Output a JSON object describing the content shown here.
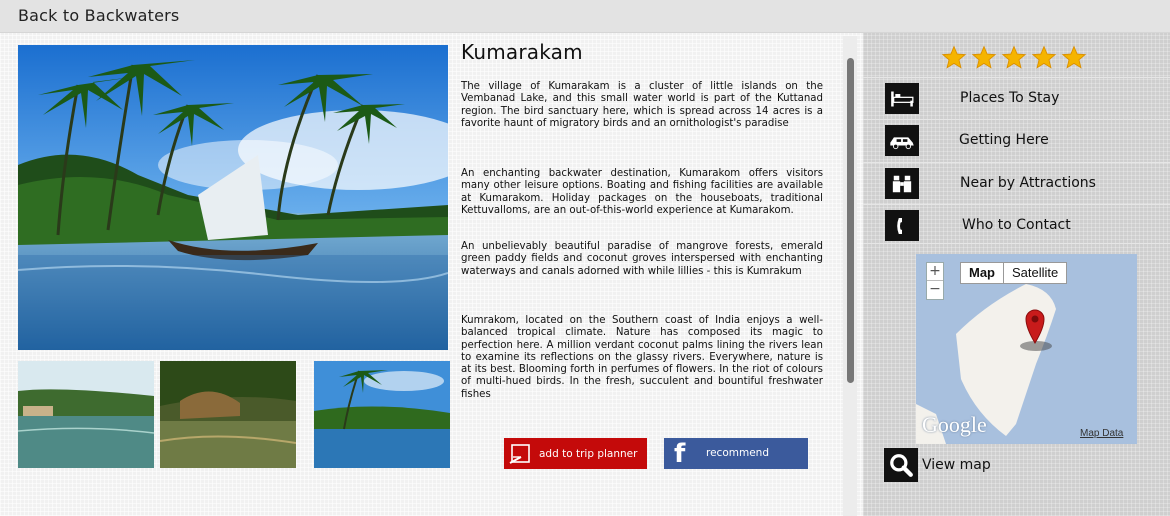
{
  "nav": {
    "back_label": "Back to Backwaters"
  },
  "article": {
    "title": "Kumarakam",
    "paragraphs": [
      "The village of Kumarakam is a cluster of little islands on the Vembanad Lake, and this small water world is part of the Kuttanad region. The bird sanctuary here, which is spread across 14 acres is a favorite haunt of migratory birds and an ornithologist's paradise",
      "An enchanting backwater destination, Kumarakom offers visitors many other leisure options. Boating and fishing facilities are available at Kumarakom. Holiday packages on the houseboats, traditional Kettuvalloms, are an out-of-this-world experience at Kumarakom.",
      "An unbelievably beautiful paradise of mangrove forests, emerald green paddy fields and coconut groves interspersed with enchanting waterways and canals adorned with while lillies - this is Kumrakum",
      "Kumrakom, located on the Southern coast of India enjoys a well-balanced tropical climate. Nature has composed its magic to perfection here. A million verdant coconut palms lining the rivers lean to examine its reflections on the glassy rivers. Everywhere, nature is at its best. Blooming forth in perfumes of flowers. In the riot of colours of multi-hued birds. In the fresh, succulent and bountiful freshwater fishes"
    ]
  },
  "actions": {
    "trip_label": "add to trip planner",
    "recommend_label": "recommend",
    "trip_color": "#c40a0a",
    "recommend_color": "#3b5a9c"
  },
  "sidebar": {
    "rating": 5,
    "star_color": "#f5b400",
    "menu": [
      {
        "label": "Places To Stay",
        "icon": "bed-icon"
      },
      {
        "label": "Getting Here",
        "icon": "car-icon"
      },
      {
        "label": "Near by Attractions",
        "icon": "binoculars-icon"
      },
      {
        "label": "Who to Contact",
        "icon": "phone-icon"
      }
    ],
    "map": {
      "type_options": [
        "Map",
        "Satellite"
      ],
      "selected_type": "Map",
      "zoom_in": "+",
      "zoom_out": "−",
      "logo": "Google",
      "data_link": "Map Data"
    },
    "view_map_label": "View map"
  },
  "images": {
    "hero": "backwater-lagoon-with-palms-and-boat",
    "thumbs": [
      "houseboat-canal",
      "covered-boat-on-river",
      "palm-lined-lake"
    ]
  }
}
